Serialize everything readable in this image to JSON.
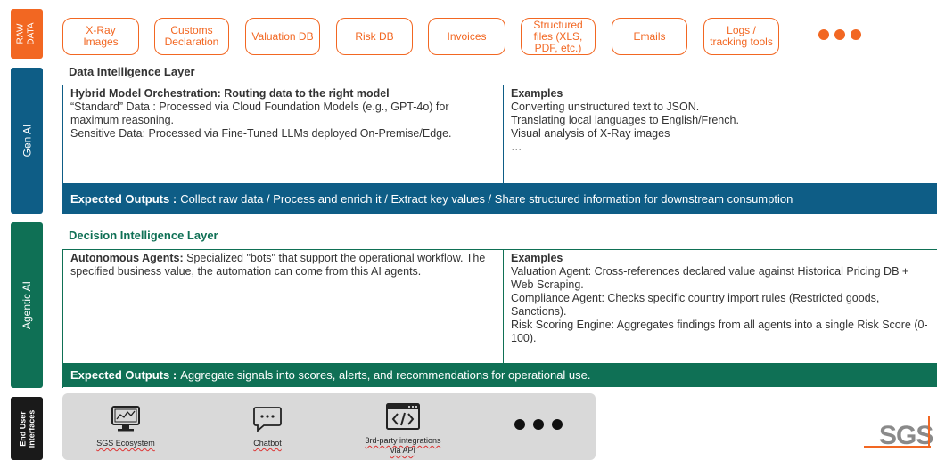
{
  "side_labels": {
    "raw": "RAW\nDATA",
    "gen": "Gen AI",
    "agentic": "Agentic AI",
    "eui": "End User\nInterfaces"
  },
  "raw_data": [
    {
      "label": "X-Ray\nImages"
    },
    {
      "label": "Customs\nDeclaration"
    },
    {
      "label": "Valuation DB"
    },
    {
      "label": "Risk DB"
    },
    {
      "label": "Invoices"
    },
    {
      "label": "Structured\nfiles (XLS,\nPDF, etc.)"
    },
    {
      "label": "Emails"
    },
    {
      "label": "Logs /\ntracking tools"
    }
  ],
  "gen_layer": {
    "title": "Data Intelligence Layer",
    "left_heading": "Hybrid Model Orchestration: Routing data to the right model",
    "left_lines": [
      "“Standard” Data : Processed via Cloud Foundation Models (e.g., GPT-4o) for maximum reasoning.",
      "Sensitive Data: Processed via Fine-Tuned LLMs deployed On-Premise/Edge."
    ],
    "right_heading": "Examples",
    "right_lines": [
      "Converting unstructured text to JSON.",
      "Translating local languages to English/French.",
      "Visual analysis of X-Ray images",
      "…"
    ],
    "output_label": "Expected Outputs :",
    "output_text": "Collect raw data / Process and enrich it / Extract key values / Share structured information for downstream consumption"
  },
  "agentic_layer": {
    "title": "Decision Intelligence Layer",
    "left_heading": "Autonomous Agents:",
    "left_text": " Specialized \"bots\" that support the operational workflow. The specified business value, the automation can come from this AI agents.",
    "right_heading": "Examples",
    "right_lines": [
      "Valuation Agent: Cross-references declared value against Historical Pricing DB + Web Scraping.",
      "Compliance Agent: Checks specific country import rules (Restricted goods, Sanctions).",
      "Risk Scoring Engine: Aggregates findings from all agents into a single Risk Score (0-100)."
    ],
    "output_label": "Expected Outputs :",
    "output_text": "Aggregate signals into scores, alerts, and recommendations for operational use."
  },
  "end_user": {
    "items": [
      {
        "label": "SGS Ecosystem",
        "icon": "monitor-dashboard-icon"
      },
      {
        "label": "Chatbot",
        "icon": "chat-bubble-icon"
      },
      {
        "label": "3rd-party integrations\nvia API",
        "icon": "code-window-icon"
      }
    ]
  },
  "logo": {
    "text": "SGS",
    "color": "#f26722"
  },
  "colors": {
    "orange": "#f26722",
    "blue": "#0e5d86",
    "green": "#0f7055",
    "black": "#1a1a1a"
  }
}
